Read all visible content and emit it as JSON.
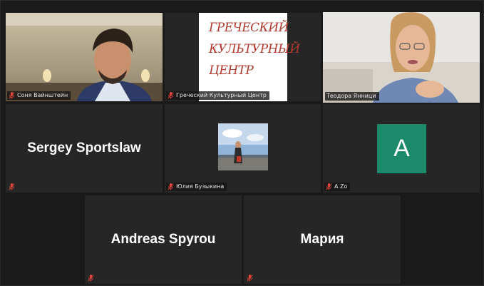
{
  "participants": [
    {
      "name": "Соня Вайнштейн",
      "muted": true,
      "type": "video"
    },
    {
      "name": "Греческий Культурный Центр",
      "muted": true,
      "type": "video"
    },
    {
      "name": "Теодора Янници",
      "muted": false,
      "type": "video",
      "active_speaker": true
    },
    {
      "name": "Sergey Sportslaw",
      "muted": true,
      "type": "name"
    },
    {
      "name": "Юлия Бузыкина",
      "muted": true,
      "type": "photo"
    },
    {
      "name": "A Zo",
      "muted": true,
      "type": "avatar",
      "avatar_letter": "A"
    },
    {
      "name": "Andreas Spyrou",
      "muted": true,
      "type": "name"
    },
    {
      "name": "Мария",
      "muted": true,
      "type": "name"
    }
  ],
  "logo": {
    "lines": [
      "ГРЕЧЕСКИЙ",
      "КУЛЬТУРНЫЙ",
      "ЦЕНТР"
    ],
    "color": "#b03a2e"
  },
  "colors": {
    "active_border": "#a8d24a",
    "mic_muted": "#e0453a",
    "avatar_bg": "#1a8a6b"
  }
}
